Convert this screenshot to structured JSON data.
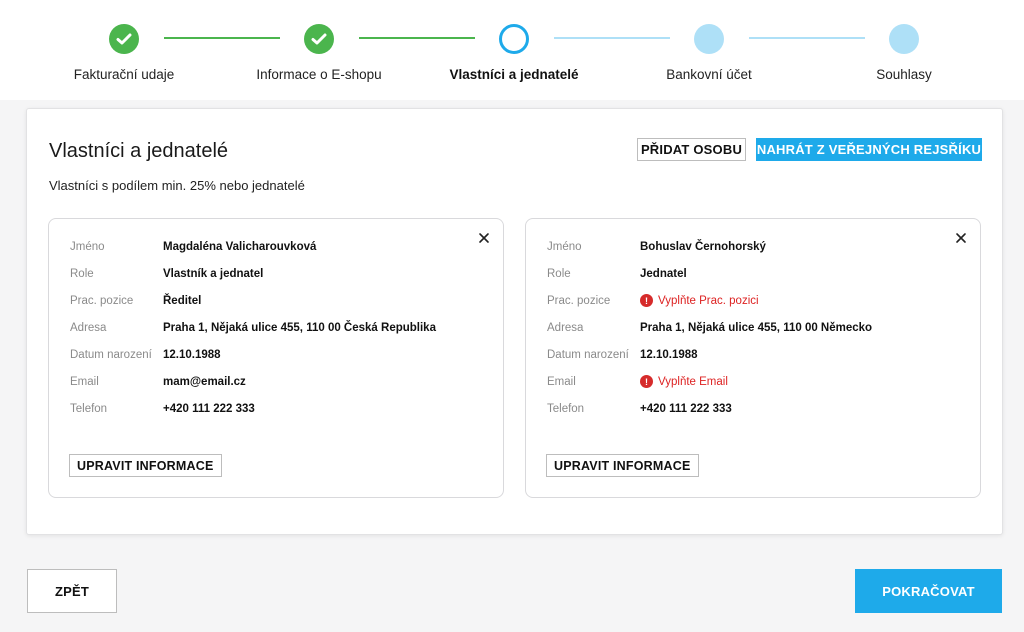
{
  "steps": [
    {
      "label": "Fakturační udaje",
      "state": "done"
    },
    {
      "label": "Informace o E-shopu",
      "state": "done"
    },
    {
      "label": "Vlastníci a jednatelé",
      "state": "current"
    },
    {
      "label": "Bankovní účet",
      "state": "future"
    },
    {
      "label": "Souhlasy",
      "state": "future"
    }
  ],
  "section": {
    "title": "Vlastníci a jednatelé",
    "subtitle": "Vlastníci s podílem min. 25% nebo jednatelé",
    "add_person_label": "PŘIDAT OSOBU",
    "import_label": "NAHRÁT Z VEŘEJNÝCH REJSŘÍKU"
  },
  "persons": [
    {
      "rows": [
        {
          "label": "Jméno",
          "value": "Magdaléna Valicharouvková"
        },
        {
          "label": "Role",
          "value": "Vlastník a jednatel"
        },
        {
          "label": "Prac. pozice",
          "value": "Ředitel"
        },
        {
          "label": "Adresa",
          "value": "Praha 1, Nějaká ulice 455, 110 00 Česká Republika"
        },
        {
          "label": "Datum narození",
          "value": "12.10.1988"
        },
        {
          "label": "Email",
          "value": "mam@email.cz"
        },
        {
          "label": "Telefon",
          "value": "+420 111 222 333"
        }
      ],
      "edit_label": "UPRAVIT INFORMACE"
    },
    {
      "rows": [
        {
          "label": "Jméno",
          "value": "Bohuslav Černohorský"
        },
        {
          "label": "Role",
          "value": "Jednatel"
        },
        {
          "label": "Prac. pozice",
          "error": "Vyplňte Prac. pozici"
        },
        {
          "label": "Adresa",
          "value": "Praha 1, Nějaká ulice 455, 110 00 Německo"
        },
        {
          "label": "Datum narození",
          "value": "12.10.1988"
        },
        {
          "label": "Email",
          "error": "Vyplňte Email"
        },
        {
          "label": "Telefon",
          "value": "+420 111 222 333"
        }
      ],
      "edit_label": "UPRAVIT INFORMACE"
    }
  ],
  "footer": {
    "back_label": "ZPĚT",
    "next_label": "POKRAČOVAT"
  },
  "colors": {
    "done": "#4bb54d",
    "current": "#1eaaea",
    "future": "#aee0f7",
    "error": "#d62b2b",
    "primary": "#1eaaea"
  },
  "icons": {
    "done_step": "check-icon",
    "close": "close-icon",
    "error": "exclamation-icon"
  }
}
